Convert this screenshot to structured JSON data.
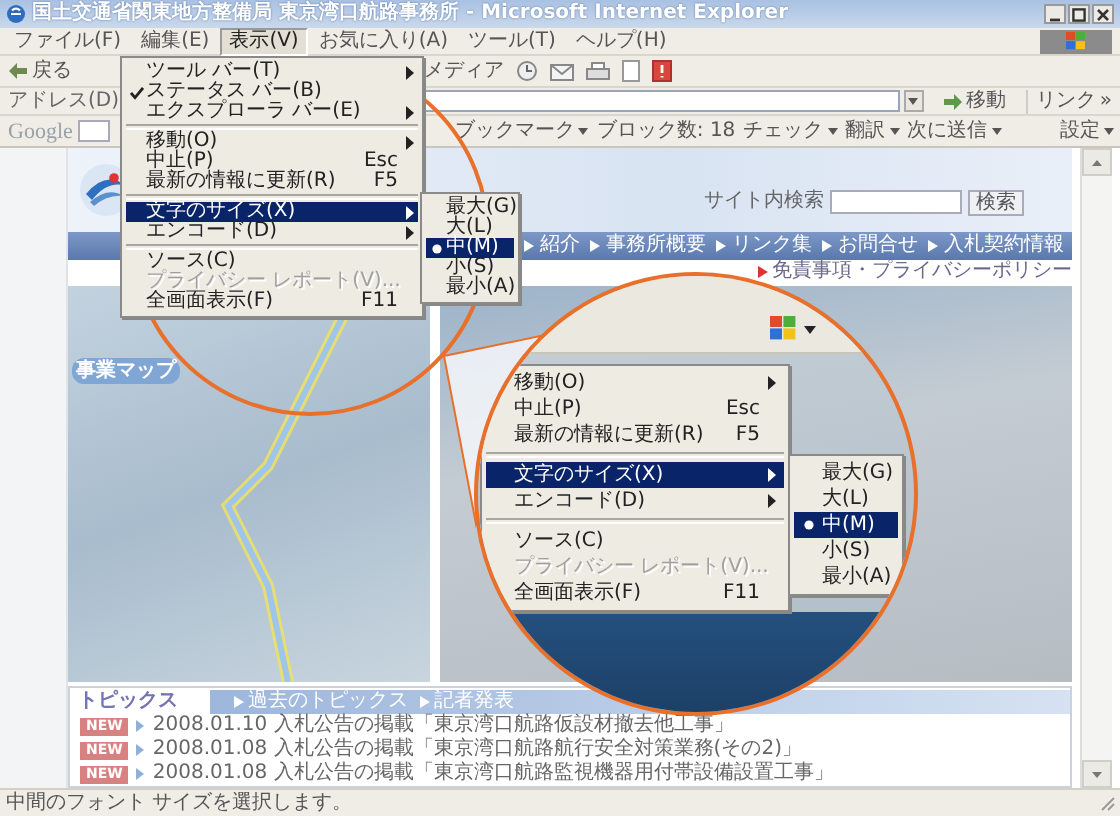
{
  "window": {
    "title": "国土交通省関東地方整備局 東京湾口航路事務所 - Microsoft Internet Explorer"
  },
  "menu_bar": [
    {
      "label": "ファイル(F)",
      "selected": false
    },
    {
      "label": "編集(E)",
      "selected": false
    },
    {
      "label": "表示(V)",
      "selected": true
    },
    {
      "label": "お気に入り(A)",
      "selected": false
    },
    {
      "label": "ツール(T)",
      "selected": false
    },
    {
      "label": "ヘルプ(H)",
      "selected": false
    }
  ],
  "toolbar": {
    "back": "戻る",
    "media": "メディア"
  },
  "address_bar": {
    "label": "アドレス(D)",
    "go": "移動",
    "links": "リンク",
    "more": "»"
  },
  "google_bar": {
    "logo": "Google",
    "items": [
      {
        "label": "ブックマーク",
        "dropdown": true
      },
      {
        "label": "ブロック数: 18",
        "dropdown": false
      },
      {
        "label": "チェック",
        "dropdown": true
      },
      {
        "label": "翻訳",
        "dropdown": true
      },
      {
        "label": "次に送信",
        "dropdown": true
      },
      {
        "label": "設定",
        "dropdown": true
      }
    ]
  },
  "page": {
    "search_label": "サイト内検索",
    "search_button": "検索",
    "nav": [
      "紹介",
      "事務所概要",
      "リンク集",
      "お問合せ",
      "入札契約情報"
    ],
    "disclaimer_link": "免責事項・プライバシーポリシー",
    "map_badge": "事業マップ"
  },
  "topics": {
    "title": "トピックス",
    "links": [
      "過去のトピックス",
      "記者発表"
    ],
    "items": [
      {
        "badge": "NEW",
        "text": "2008.01.10 入札公告の掲載「東京湾口航路仮設材撤去他工事」"
      },
      {
        "badge": "NEW",
        "text": "2008.01.08 入札公告の掲載「東京湾口航路航行安全対策業務(その2)」"
      },
      {
        "badge": "NEW",
        "text": "2008.01.08 入札公告の掲載「東京湾口航路監視機器用付帯設備設置工事」"
      }
    ]
  },
  "view_menu": {
    "items": [
      {
        "kind": "item",
        "label": "ツール バー(T)",
        "submenu": true,
        "checked": false,
        "disabled": false,
        "selected": false
      },
      {
        "kind": "item",
        "label": "ステータス バー(B)",
        "submenu": false,
        "checked": true,
        "disabled": false,
        "selected": false
      },
      {
        "kind": "item",
        "label": "エクスプローラ バー(E)",
        "submenu": true,
        "checked": false,
        "disabled": false,
        "selected": false
      },
      {
        "kind": "separator"
      },
      {
        "kind": "item",
        "label": "移動(O)",
        "submenu": true,
        "checked": false,
        "disabled": false,
        "selected": false
      },
      {
        "kind": "item",
        "label": "中止(P)",
        "shortcut": "Esc",
        "submenu": false,
        "checked": false,
        "disabled": false,
        "selected": false
      },
      {
        "kind": "item",
        "label": "最新の情報に更新(R)",
        "shortcut": "F5",
        "submenu": false,
        "checked": false,
        "disabled": false,
        "selected": false
      },
      {
        "kind": "separator"
      },
      {
        "kind": "item",
        "label": "文字のサイズ(X)",
        "submenu": true,
        "checked": false,
        "disabled": false,
        "selected": true
      },
      {
        "kind": "item",
        "label": "エンコード(D)",
        "submenu": true,
        "checked": false,
        "disabled": false,
        "selected": false
      },
      {
        "kind": "separator"
      },
      {
        "kind": "item",
        "label": "ソース(C)",
        "submenu": false,
        "checked": false,
        "disabled": false,
        "selected": false
      },
      {
        "kind": "item",
        "label": "プライバシー レポート(V)...",
        "submenu": false,
        "checked": false,
        "disabled": true,
        "selected": false
      },
      {
        "kind": "item",
        "label": "全画面表示(F)",
        "shortcut": "F11",
        "submenu": false,
        "checked": false,
        "disabled": false,
        "selected": false
      }
    ]
  },
  "font_size_menu": {
    "items": [
      {
        "label": "最大(G)",
        "selected": false
      },
      {
        "label": "大(L)",
        "selected": false
      },
      {
        "label": "中(M)",
        "selected": true
      },
      {
        "label": "小(S)",
        "selected": false
      },
      {
        "label": "最小(A)",
        "selected": false
      }
    ]
  },
  "magnifier": {
    "menu_items": [
      {
        "kind": "item",
        "label": "移動(O)",
        "submenu": true,
        "disabled": false,
        "selected": false
      },
      {
        "kind": "item",
        "label": "中止(P)",
        "shortcut": "Esc",
        "submenu": false,
        "disabled": false,
        "selected": false
      },
      {
        "kind": "item",
        "label": "最新の情報に更新(R)",
        "shortcut": "F5",
        "submenu": false,
        "disabled": false,
        "selected": false
      },
      {
        "kind": "separator"
      },
      {
        "kind": "item",
        "label": "文字のサイズ(X)",
        "submenu": true,
        "disabled": false,
        "selected": true
      },
      {
        "kind": "item",
        "label": "エンコード(D)",
        "submenu": true,
        "disabled": false,
        "selected": false
      },
      {
        "kind": "separator"
      },
      {
        "kind": "item",
        "label": "ソース(C)",
        "submenu": false,
        "disabled": false,
        "selected": false
      },
      {
        "kind": "item",
        "label": "プライバシー レポート(V)...",
        "submenu": false,
        "disabled": true,
        "selected": false
      },
      {
        "kind": "item",
        "label": "全画面表示(F)",
        "shortcut": "F11",
        "submenu": false,
        "disabled": false,
        "selected": false
      }
    ],
    "font_size_items": [
      {
        "label": "最大(G)",
        "selected": false
      },
      {
        "label": "大(L)",
        "selected": false
      },
      {
        "label": "中(M)",
        "selected": true
      },
      {
        "label": "小(S)",
        "selected": false
      },
      {
        "label": "最小(A)",
        "selected": false
      }
    ]
  },
  "status_bar": {
    "text": "中間のフォント サイズを選択します。"
  }
}
